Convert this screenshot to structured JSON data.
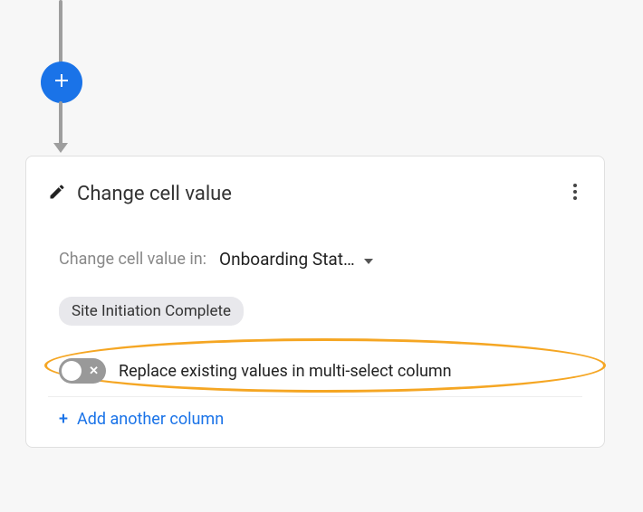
{
  "card": {
    "title": "Change cell value",
    "field_label": "Change cell value in:",
    "dropdown_value": "Onboarding Stat…",
    "chip_value": "Site Initiation Complete",
    "toggle_label": "Replace existing values in multi-select column",
    "add_column_label": "Add another column",
    "add_column_plus": "+"
  }
}
